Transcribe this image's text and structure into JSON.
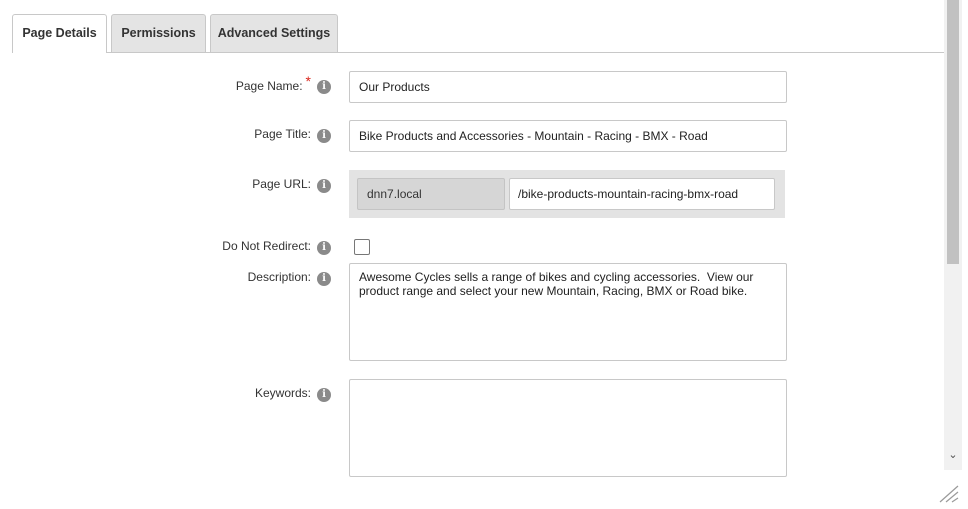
{
  "tabs": [
    {
      "label": "Page Details",
      "active": true
    },
    {
      "label": "Permissions",
      "active": false
    },
    {
      "label": "Advanced Settings",
      "active": false
    }
  ],
  "fields": {
    "page_name": {
      "label": "Page Name:",
      "required_mark": "*",
      "value": "Our Products"
    },
    "page_title": {
      "label": "Page Title:",
      "value": "Bike Products and Accessories - Mountain - Racing - BMX - Road"
    },
    "page_url": {
      "label": "Page URL:",
      "domain": "dnn7.local",
      "path": "/bike-products-mountain-racing-bmx-road"
    },
    "do_not_redirect": {
      "label": "Do Not Redirect:",
      "checked": false
    },
    "description": {
      "label": "Description:",
      "value": "Awesome Cycles sells a range of bikes and cycling accessories.  View our product range and select your new Mountain, Racing, BMX or Road bike."
    },
    "keywords": {
      "label": "Keywords:",
      "value": ""
    }
  },
  "icons": {
    "info": "info-icon",
    "info_glyph": "i",
    "scroll_down": "chevron-down-icon",
    "scroll_down_glyph": "⌄",
    "resize": "resize-grip-icon"
  },
  "colors": {
    "required": "#d9261c",
    "tab_inactive_bg": "#e4e4e4",
    "url_box_bg": "#e3e3e3",
    "info_icon": "#8a8a8a"
  }
}
